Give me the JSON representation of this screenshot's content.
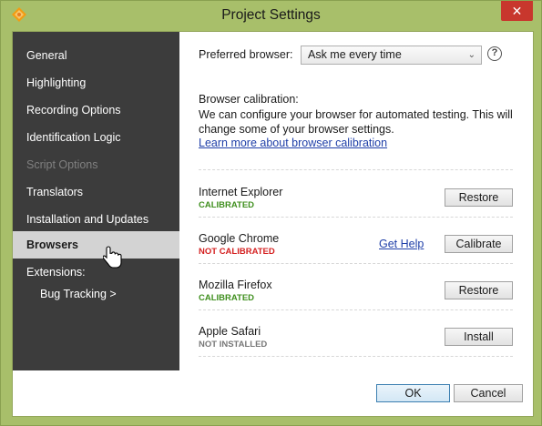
{
  "window": {
    "title": "Project Settings",
    "close_label": "✕",
    "app_icon": "app-logo-icon"
  },
  "sidebar": {
    "items": [
      {
        "label": "General",
        "state": "normal"
      },
      {
        "label": "Highlighting",
        "state": "normal"
      },
      {
        "label": "Recording Options",
        "state": "normal"
      },
      {
        "label": "Identification Logic",
        "state": "normal"
      },
      {
        "label": "Script Options",
        "state": "disabled"
      },
      {
        "label": "Translators",
        "state": "normal"
      },
      {
        "label": "Installation and Updates",
        "state": "normal"
      },
      {
        "label": "Browsers",
        "state": "selected"
      }
    ],
    "extensions_label": "Extensions:",
    "extensions_items": [
      {
        "label": "Bug Tracking >"
      }
    ]
  },
  "preferences": {
    "browser_label": "Preferred browser:",
    "browser_value": "Ask me every time",
    "help_icon": "?"
  },
  "calibration": {
    "heading": "Browser calibration:",
    "description": "We can configure your browser for automated testing. This will change some of your browser settings.",
    "link": "Learn more about browser calibration"
  },
  "browsers": [
    {
      "name": "Internet Explorer",
      "status": "CALIBRATED",
      "status_color": "#3f8f1e",
      "action": "Restore"
    },
    {
      "name": "Google Chrome",
      "status": "NOT CALIBRATED",
      "status_color": "#d42020",
      "help_link": "Get Help",
      "action": "Calibrate"
    },
    {
      "name": "Mozilla Firefox",
      "status": "CALIBRATED",
      "status_color": "#3f8f1e",
      "action": "Restore"
    },
    {
      "name": "Apple Safari",
      "status": "NOT INSTALLED",
      "status_color": "#777777",
      "action": "Install"
    }
  ],
  "footer": {
    "ok_label": "OK",
    "cancel_label": "Cancel"
  },
  "colors": {
    "window_frame": "#a8bf6a",
    "sidebar_bg": "#3c3c3c",
    "selected_bg": "#d3d3d3",
    "close_button": "#c8372d",
    "link": "#1f3fa8"
  }
}
